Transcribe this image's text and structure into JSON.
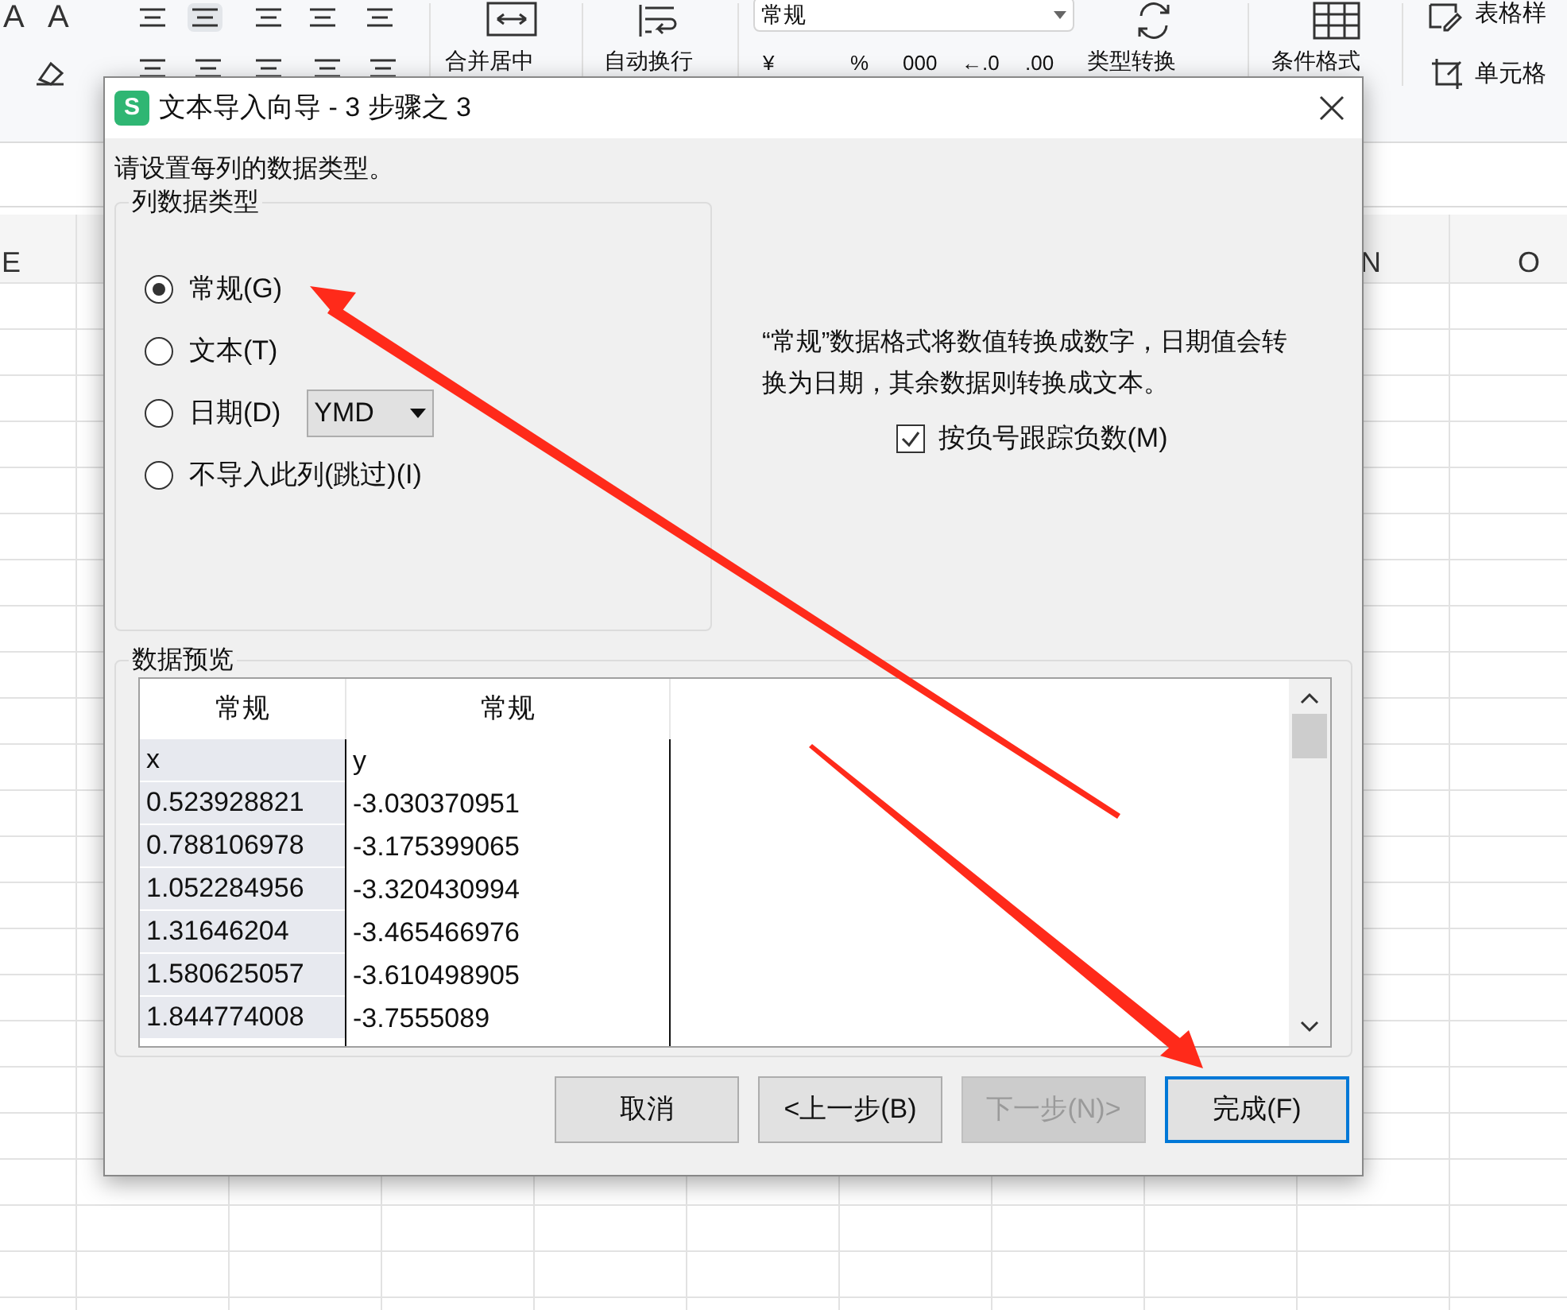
{
  "toolbar": {
    "font_buttons": [
      "A",
      "A"
    ],
    "labels": [
      {
        "kind": "merge",
        "text": "合并居中"
      },
      {
        "kind": "wrap",
        "text": "自动换行"
      }
    ],
    "number_format": "常规",
    "number_buttons": [
      "¥",
      "%",
      "000",
      "←.0",
      ".00"
    ],
    "convert": "类型转换",
    "conditional": "条件格式",
    "table_style": "表格样",
    "cell_style": "单元格"
  },
  "sheet": {
    "columns": [
      {
        "label": "E"
      },
      {
        "label": "N"
      },
      {
        "label": "O"
      }
    ]
  },
  "dialog": {
    "logo": "S",
    "title": "文本导入向导 - 3 步骤之 3",
    "prompt": "请设置每列的数据类型。",
    "group_title": "列数据类型",
    "types": [
      {
        "label": "常规(G)",
        "selected": true
      },
      {
        "label": "文本(T)",
        "selected": false
      },
      {
        "label": "日期(D)",
        "selected": false,
        "dropdown": "YMD"
      },
      {
        "label": "不导入此列(跳过)(I)",
        "selected": false
      }
    ],
    "description": "“常规”数据格式将数值转换成数字，日期值会转换为日期，其余数据则转换成文本。",
    "negative_checkbox": {
      "label": "按负号跟踪负数(M)",
      "checked": true
    },
    "preview_title": "数据预览",
    "preview_columns": [
      "常规",
      "常规"
    ],
    "preview_rows": [
      [
        "x",
        "y"
      ],
      [
        "0.523928821",
        "-3.030370951"
      ],
      [
        "0.788106978",
        "-3.175399065"
      ],
      [
        "1.052284956",
        "-3.320430994"
      ],
      [
        "1.31646204",
        "-3.465466976"
      ],
      [
        "1.580625057",
        "-3.610498905"
      ],
      [
        "1.844774008",
        "-3.7555089"
      ]
    ],
    "buttons": [
      {
        "label": "取消",
        "disabled": false,
        "default": false
      },
      {
        "label": "<上一步(B)",
        "disabled": false,
        "default": false
      },
      {
        "label": "下一步(N)>",
        "disabled": true,
        "default": false
      },
      {
        "label": "完成(F)",
        "disabled": false,
        "default": true
      }
    ]
  }
}
